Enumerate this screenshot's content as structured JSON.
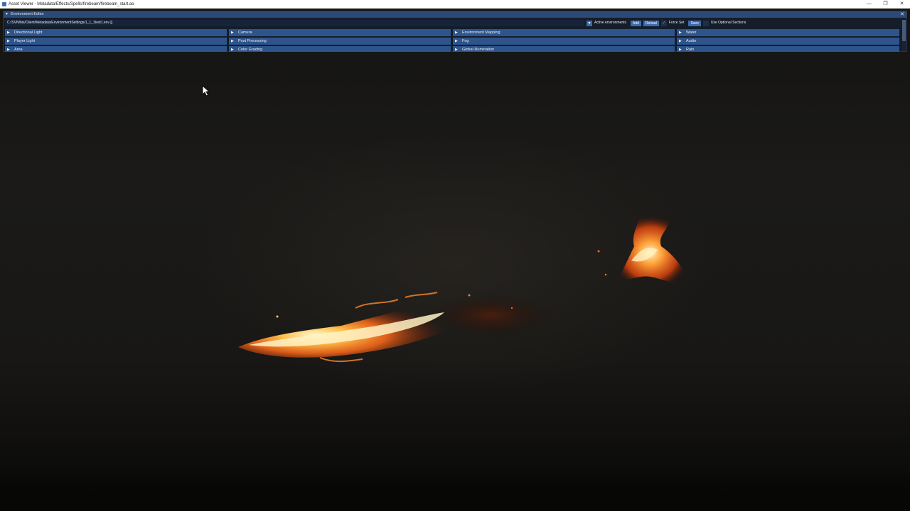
{
  "window": {
    "title": "Asset Viewer - Metadata/Effects/Spells/firebeam/firebeam_start.ao",
    "controls": [
      "—",
      "❐",
      "✕"
    ]
  },
  "editor": {
    "title": "Environment Editor",
    "file_path": "C:/SVN/bis/Client/Metadata/EnvironmentSettings/1_1_1test1.env []",
    "toolbar": {
      "active_environments_label": "Active environments",
      "add_label": "Add",
      "reload_label": "Reload",
      "force_set_label": "Force Set",
      "force_set_checked": true,
      "save_label": "Save",
      "use_optional_label": "Use Optional Sections",
      "use_optional_checked": false
    },
    "sections": [
      [
        "Directional Light",
        "Camera",
        "Environment Mapping",
        "Water"
      ],
      [
        "Player Light",
        "Post Processing",
        "Fog",
        "Audio"
      ],
      [
        "Area",
        "Color Grading",
        "Global Illumination",
        "Rain"
      ]
    ]
  },
  "colors": {
    "panel_header": "#2c4a78",
    "section_bar": "#2e548c",
    "button": "#3b6bb0",
    "fire_core": "#fff3c0",
    "fire_mid": "#ff9a2e",
    "fire_edge": "#c83a0a"
  },
  "icons": {
    "collapse": "triangle-down-icon",
    "section": "triangle-right-icon",
    "dropdown": "triangle-down-icon",
    "check": "checkmark-icon",
    "cursor": "mouse-pointer-icon"
  }
}
